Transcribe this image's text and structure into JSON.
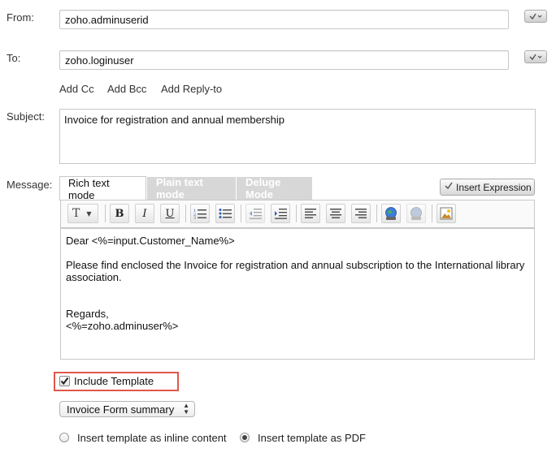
{
  "from": {
    "label": "From:",
    "value": "zoho.adminuserid"
  },
  "to": {
    "label": "To:",
    "value": "zoho.loginuser"
  },
  "recipient_links": {
    "add_cc": "Add Cc",
    "add_bcc": "Add Bcc",
    "add_reply_to": "Add Reply-to"
  },
  "subject": {
    "label": "Subject:",
    "value": "Invoice for registration and annual membership"
  },
  "message": {
    "label": "Message:",
    "tabs": [
      {
        "label": "Rich text mode",
        "active": true
      },
      {
        "label": "Plain text mode",
        "active": false
      },
      {
        "label": "Deluge Mode",
        "active": false
      }
    ],
    "insert_expression": "Insert Expression",
    "toolbar": {
      "text_style_glyph": "T",
      "bold_glyph": "B",
      "italic_glyph": "I",
      "underline_glyph": "U",
      "icons": [
        "text-format-icon",
        "bold-icon",
        "italic-icon",
        "underline-icon",
        "numbered-list-icon",
        "bulleted-list-icon",
        "outdent-icon",
        "indent-icon",
        "align-left-icon",
        "align-center-icon",
        "align-right-icon",
        "insert-link-icon",
        "remove-link-icon",
        "insert-image-icon"
      ]
    },
    "body": {
      "line1": "Dear <%=input.Customer_Name%>",
      "line2": "Please find enclosed the Invoice for registration and annual subscription to the International library association.",
      "line3": "Regards,",
      "line4": "<%=zoho.adminuser%>"
    }
  },
  "include_template": {
    "label": "Include Template",
    "checked": true,
    "highlight_color": "#e0574a"
  },
  "template_select": {
    "value": "Invoice Form summary"
  },
  "insert_options": {
    "inline": {
      "label": "Insert template as inline content",
      "selected": false
    },
    "pdf": {
      "label": "Insert template as PDF",
      "selected": true
    }
  }
}
